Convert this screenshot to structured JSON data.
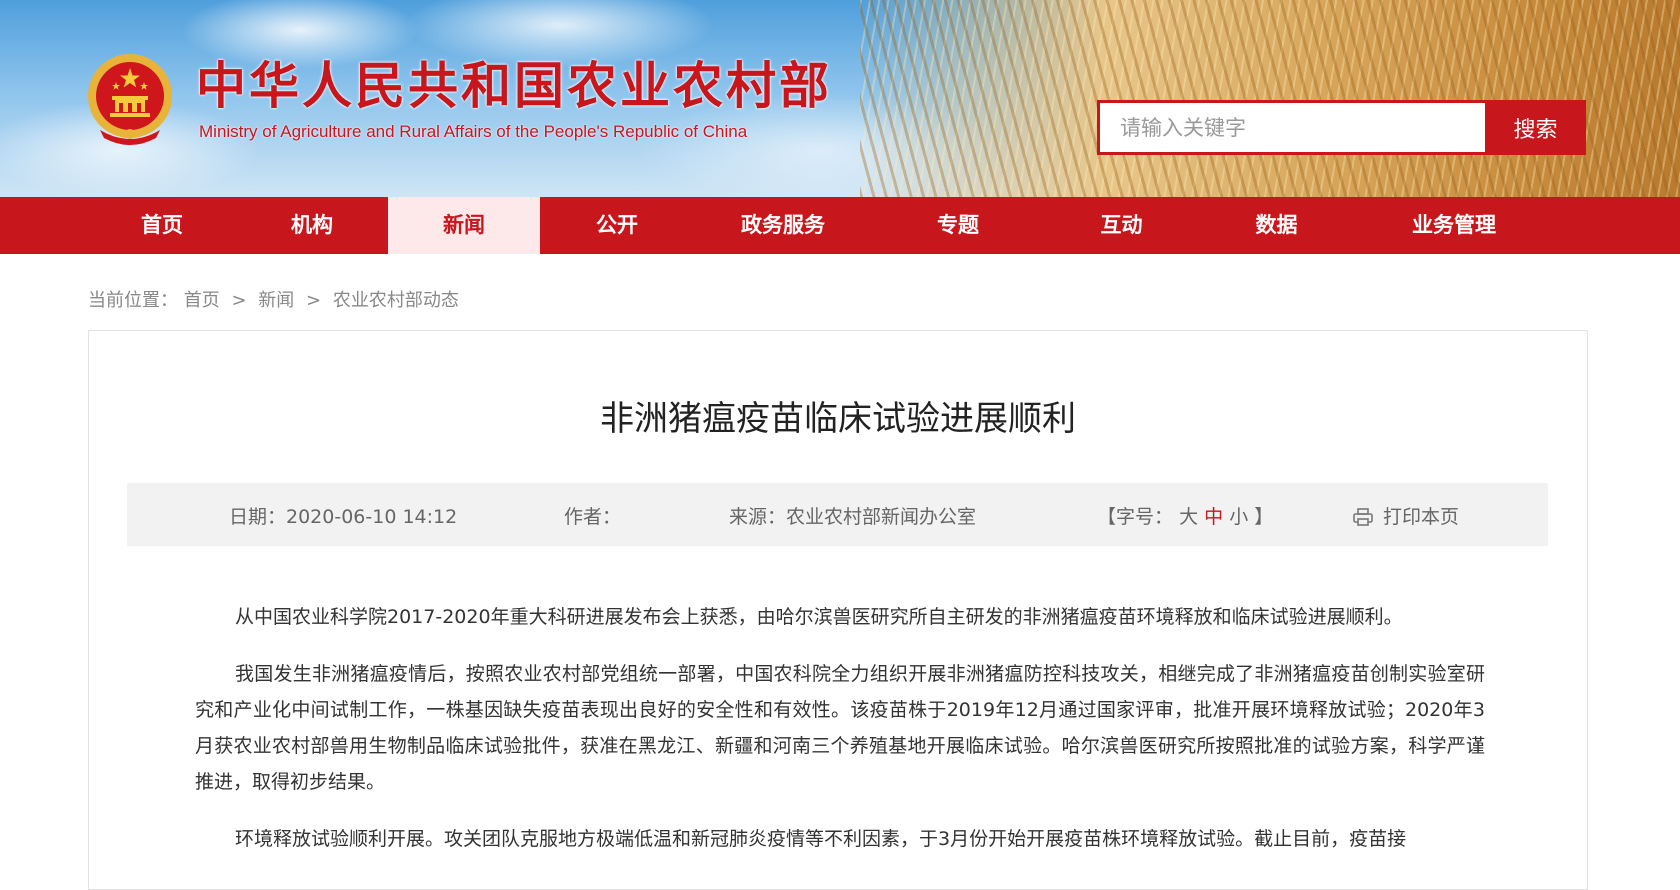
{
  "header": {
    "title_cn": "中华人民共和国农业农村部",
    "title_en": "Ministry of Agriculture and Rural Affairs of the People's Republic of China",
    "brand_color": "#c8161d",
    "emblem_icon": "national-emblem-icon",
    "search": {
      "placeholder": "请输入关键字",
      "button_label": "搜索"
    }
  },
  "nav": {
    "items": [
      {
        "label": "首页"
      },
      {
        "label": "机构"
      },
      {
        "label": "新闻",
        "active": true
      },
      {
        "label": "公开"
      },
      {
        "label": "政务服务"
      },
      {
        "label": "专题"
      },
      {
        "label": "互动"
      },
      {
        "label": "数据"
      },
      {
        "label": "业务管理"
      }
    ]
  },
  "breadcrumb": {
    "prefix": "当前位置：",
    "items": [
      "首页",
      "新闻",
      "农业农村部动态"
    ],
    "separator": ">"
  },
  "article": {
    "title": "非洲猪瘟疫苗临床试验进展顺利",
    "date": "日期：2020-06-10 14:12",
    "author": "作者：",
    "source": "来源：农业农村部新闻办公室",
    "font_size": {
      "open": "【字号：",
      "large": "大",
      "medium": "中",
      "small": "小",
      "close": "】",
      "selected": "medium"
    },
    "print_label": "打印本页",
    "print_icon": "printer-icon",
    "paragraphs": [
      "从中国农业科学院2017-2020年重大科研进展发布会上获悉，由哈尔滨兽医研究所自主研发的非洲猪瘟疫苗环境释放和临床试验进展顺利。",
      "我国发生非洲猪瘟疫情后，按照农业农村部党组统一部署，中国农科院全力组织开展非洲猪瘟防控科技攻关，相继完成了非洲猪瘟疫苗创制实验室研究和产业化中间试制工作，一株基因缺失疫苗表现出良好的安全性和有效性。该疫苗株于2019年12月通过国家评审，批准开展环境释放试验；2020年3月获农业农村部兽用生物制品临床试验批件，获准在黑龙江、新疆和河南三个养殖基地开展临床试验。哈尔滨兽医研究所按照批准的试验方案，科学严谨推进，取得初步结果。",
      "环境释放试验顺利开展。攻关团队克服地方极端低温和新冠肺炎疫情等不利因素，于3月份开始开展疫苗株环境释放试验。截止目前，疫苗接"
    ]
  }
}
